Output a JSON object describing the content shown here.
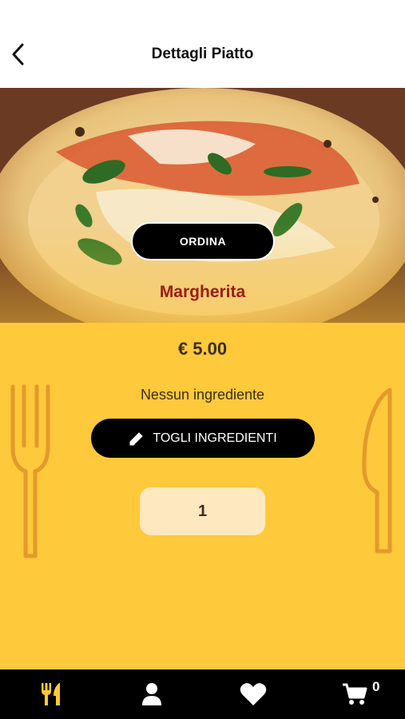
{
  "header": {
    "title": "Dettagli Piatto"
  },
  "dish": {
    "order_label": "ORDINA",
    "name": "Margherita",
    "price": "€ 5.00",
    "ingredients_text": "Nessun ingrediente",
    "edit_ingredients_label": "TOGLI INGREDIENTI",
    "quantity": "1"
  },
  "tabbar": {
    "cart_count": "0"
  },
  "colors": {
    "accent_yellow": "#fec93a",
    "dish_name_red": "#9b1c12",
    "cutlery_orange": "#e39a2b",
    "quantity_bg": "#fde8bf",
    "active_tab": "#fec93a"
  },
  "icons": [
    "chevron-left-icon",
    "pencil-icon",
    "fork-icon",
    "knife-icon",
    "menu-cutlery-icon",
    "user-icon",
    "heart-icon",
    "cart-icon"
  ]
}
